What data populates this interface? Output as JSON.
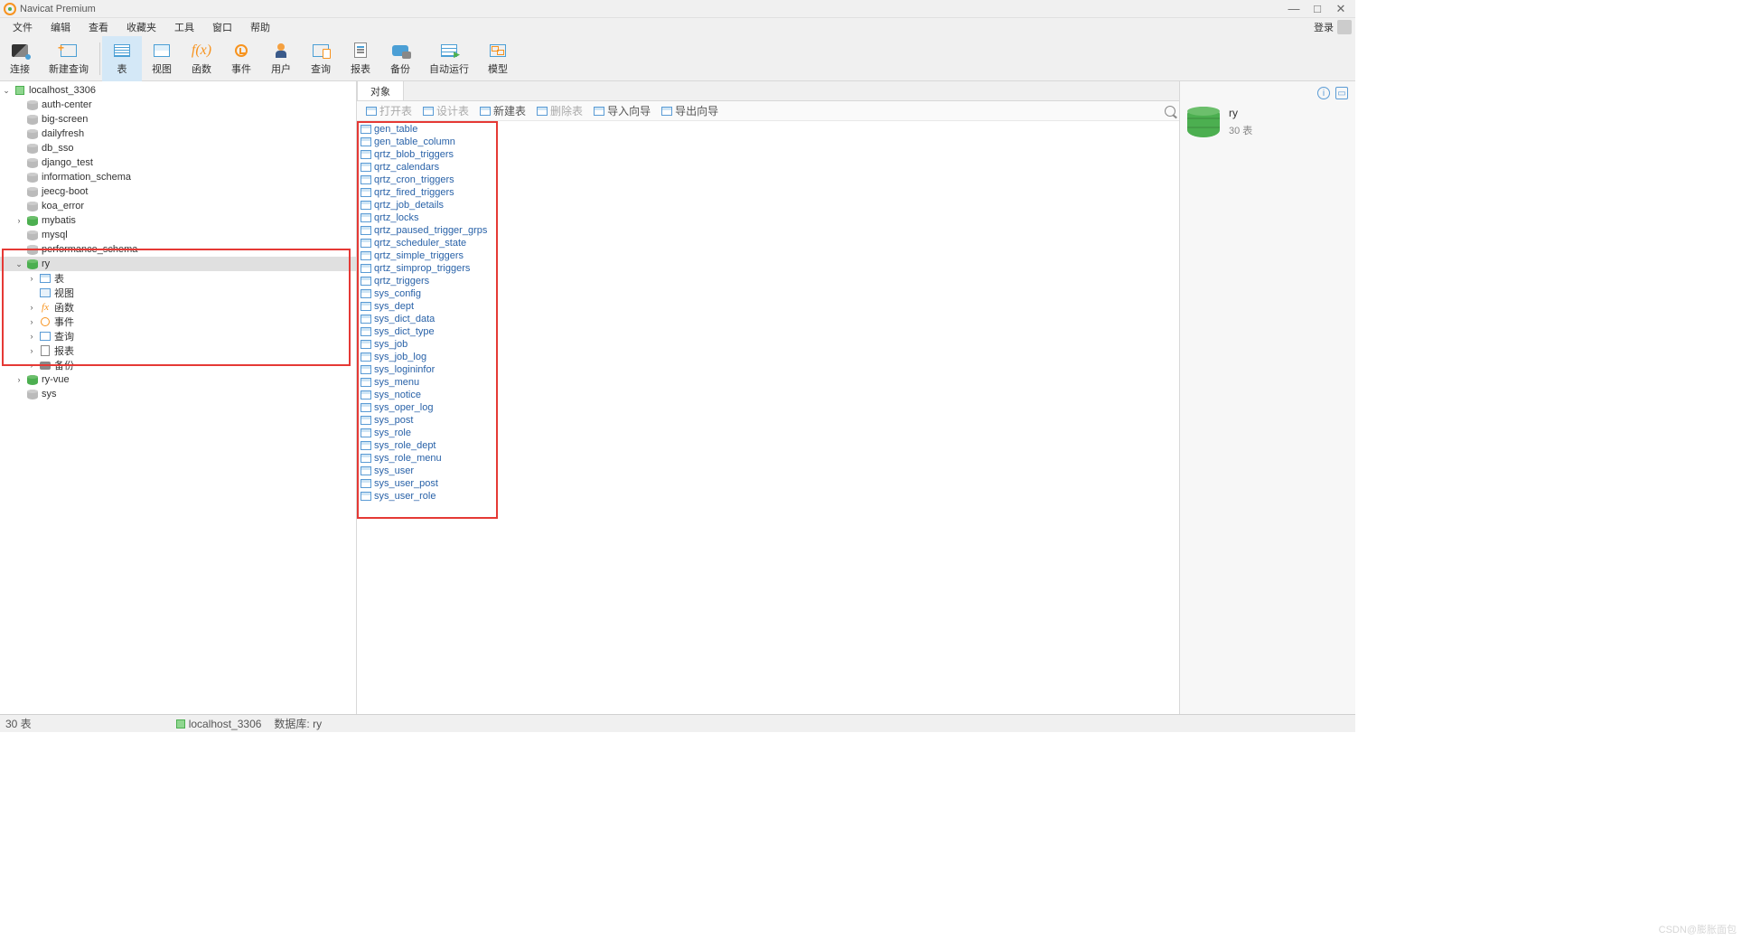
{
  "app": {
    "title": "Navicat Premium",
    "login": "登录"
  },
  "menubar": [
    "文件",
    "编辑",
    "查看",
    "收藏夹",
    "工具",
    "窗口",
    "帮助"
  ],
  "toolbar": [
    {
      "key": "connect",
      "label": "连接"
    },
    {
      "key": "newquery",
      "label": "新建查询"
    },
    {
      "key": "table",
      "label": "表",
      "active": true
    },
    {
      "key": "view",
      "label": "视图"
    },
    {
      "key": "function",
      "label": "函数"
    },
    {
      "key": "event",
      "label": "事件"
    },
    {
      "key": "user",
      "label": "用户"
    },
    {
      "key": "query",
      "label": "查询"
    },
    {
      "key": "report",
      "label": "报表"
    },
    {
      "key": "backup",
      "label": "备份"
    },
    {
      "key": "auto",
      "label": "自动运行"
    },
    {
      "key": "model",
      "label": "模型"
    }
  ],
  "sidebar": {
    "connection": "localhost_3306",
    "databases": [
      "auth-center",
      "big-screen",
      "dailyfresh",
      "db_sso",
      "django_test",
      "information_schema",
      "jeecg-boot",
      "koa_error",
      "mybatis",
      "mysql",
      "performance_schema"
    ],
    "selected_db": "ry",
    "ry_children": [
      "表",
      "视图",
      "函数",
      "事件",
      "查询",
      "报表",
      "备份"
    ],
    "after_ry": [
      "ry-vue",
      "sys"
    ]
  },
  "content": {
    "tab": "对象",
    "sub_buttons": [
      {
        "label": "打开表",
        "disabled": true
      },
      {
        "label": "设计表",
        "disabled": true
      },
      {
        "label": "新建表",
        "disabled": false
      },
      {
        "label": "删除表",
        "disabled": true
      },
      {
        "label": "导入向导",
        "disabled": false
      },
      {
        "label": "导出向导",
        "disabled": false
      }
    ],
    "tables": [
      "gen_table",
      "gen_table_column",
      "qrtz_blob_triggers",
      "qrtz_calendars",
      "qrtz_cron_triggers",
      "qrtz_fired_triggers",
      "qrtz_job_details",
      "qrtz_locks",
      "qrtz_paused_trigger_grps",
      "qrtz_scheduler_state",
      "qrtz_simple_triggers",
      "qrtz_simprop_triggers",
      "qrtz_triggers",
      "sys_config",
      "sys_dept",
      "sys_dict_data",
      "sys_dict_type",
      "sys_job",
      "sys_job_log",
      "sys_logininfor",
      "sys_menu",
      "sys_notice",
      "sys_oper_log",
      "sys_post",
      "sys_role",
      "sys_role_dept",
      "sys_role_menu",
      "sys_user",
      "sys_user_post",
      "sys_user_role"
    ]
  },
  "infopanel": {
    "db_name": "ry",
    "table_count": "30 表"
  },
  "statusbar": {
    "left": "30 表",
    "conn": "localhost_3306",
    "db": "数据库: ry"
  },
  "watermark": "CSDN@膨胀面包"
}
